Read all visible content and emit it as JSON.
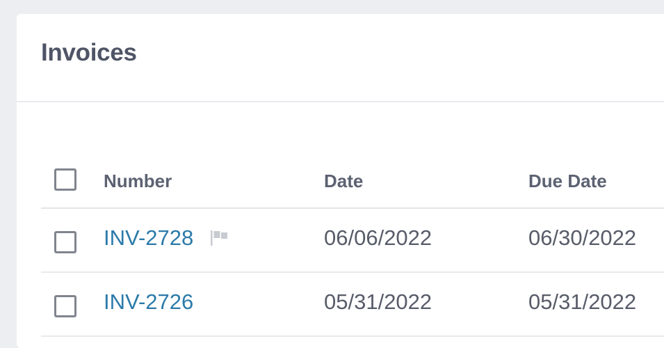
{
  "page": {
    "title": "Invoices"
  },
  "table": {
    "columns": [
      "Number",
      "Date",
      "Due Date"
    ],
    "rows": [
      {
        "number": "INV-2728",
        "date": "06/06/2022",
        "due_date": "06/30/2022",
        "flagged": true
      },
      {
        "number": "INV-2726",
        "date": "05/31/2022",
        "due_date": "05/31/2022",
        "flagged": false
      }
    ]
  },
  "colors": {
    "link": "#2b7aa9",
    "title": "#4f5566",
    "background": "#eceef2"
  }
}
